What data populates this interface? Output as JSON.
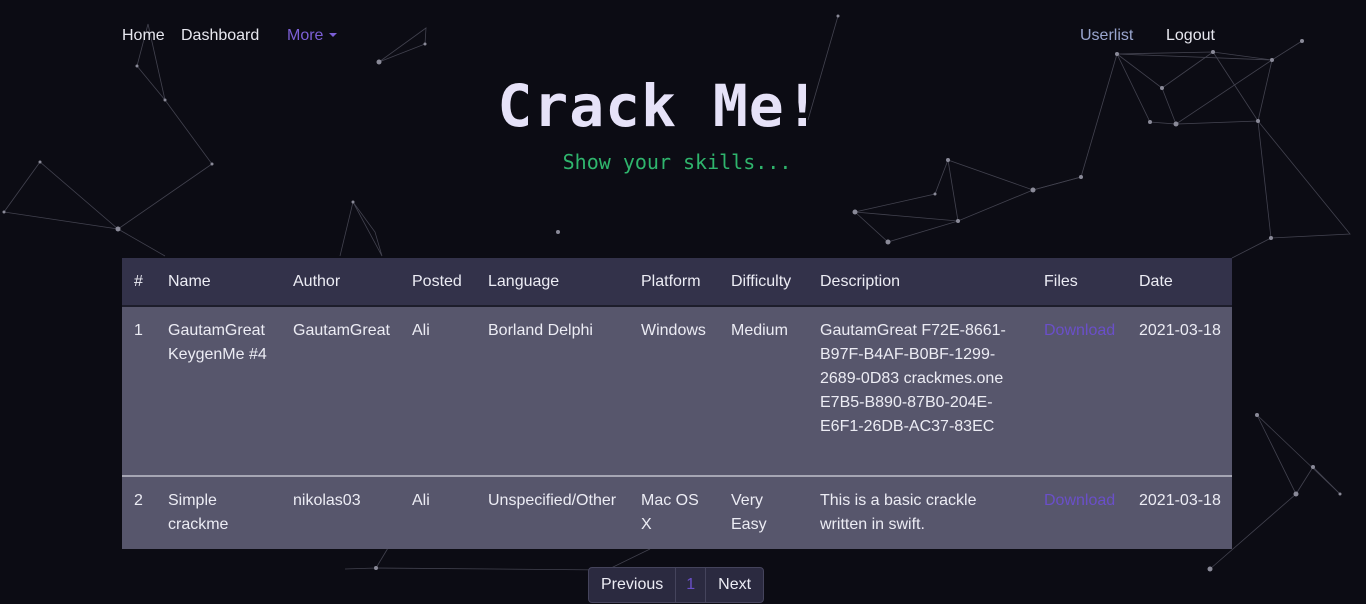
{
  "nav": {
    "home": "Home",
    "dashboard": "Dashboard",
    "more": "More",
    "userlist": "Userlist",
    "logout": "Logout"
  },
  "hero": {
    "title": "Crack Me!",
    "subtitle": "Show your skills..."
  },
  "table": {
    "headers": [
      "#",
      "Name",
      "Author",
      "Posted",
      "Language",
      "Platform",
      "Difficulty",
      "Description",
      "Files",
      "Date"
    ],
    "rows": [
      {
        "num": "1",
        "name": "GautamGreat KeygenMe #4",
        "author": "GautamGreat",
        "posted": "Ali",
        "language": "Borland Delphi",
        "platform": "Windows",
        "difficulty": "Medium",
        "description": "GautamGreat F72E-8661-B97F-B4AF-B0BF-1299-2689-0D83 crackmes.one E7B5-B890-87B0-204E-E6F1-26DB-AC37-83EC",
        "files": "Download",
        "date": "2021-03-18"
      },
      {
        "num": "2",
        "name": "Simple crackme",
        "author": "nikolas03",
        "posted": "Ali",
        "language": "Unspecified/Other",
        "platform": "Mac OS X",
        "difficulty": "Very Easy",
        "description": "This is a basic crackle written in swift.",
        "files": "Download",
        "date": "2021-03-18"
      }
    ]
  },
  "pagination": {
    "previous": "Previous",
    "current": "1",
    "next": "Next"
  },
  "colors": {
    "background": "#0c0c14",
    "accent": "#7c5fd6",
    "subtitle": "#2fb56d",
    "table_header": "#33324a",
    "table_row": "#57566c"
  }
}
